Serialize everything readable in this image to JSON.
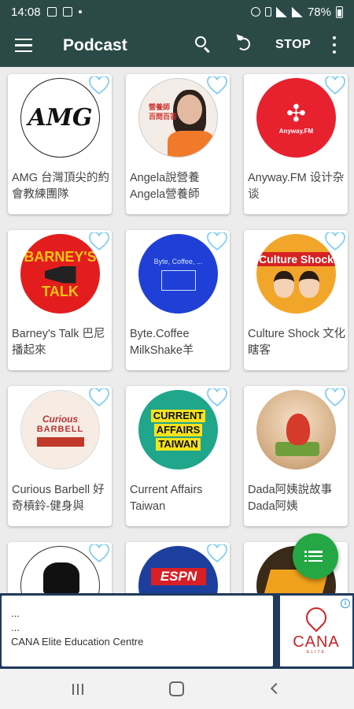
{
  "status": {
    "time": "14:08",
    "battery": "78%"
  },
  "app_bar": {
    "title": "Podcast",
    "stop_label": "STOP"
  },
  "podcasts": [
    {
      "title": "AMG 台灣頂尖的約會教練團隊",
      "cover_text": "AMG"
    },
    {
      "title": "Angela說營養Angela營養師",
      "cover_text": "營養師\n百問百答"
    },
    {
      "title": "Anyway.FM 设计杂谈",
      "cover_text": "Anyway.FM"
    },
    {
      "title": "Barney's Talk 巴尼播起來",
      "cover_text": "BARNEY'S TALK"
    },
    {
      "title": "Byte.Coffee MilkShake羊",
      "cover_text": "Byte, Coffee, ..."
    },
    {
      "title": "Culture Shock 文化瞎客",
      "cover_text": "Culture Shock"
    },
    {
      "title": "Curious Barbell 好奇槓鈴-健身與",
      "cover_text": "CURIOUS BARBELL"
    },
    {
      "title": "Current Affairs Taiwan",
      "cover_text": "CURRENT AFFAIRS TAIWAN"
    },
    {
      "title": "Dada阿姨說故事 Dada阿姨",
      "cover_text": ""
    },
    {
      "title": "",
      "cover_text": ""
    },
    {
      "title": "",
      "cover_text": "ESPN"
    },
    {
      "title": "",
      "cover_text": ""
    }
  ],
  "cover_labels": {
    "amg": "AMG",
    "angela_line1": "營養師",
    "angela_line2": "百問百答",
    "anyway_logo": "✣",
    "anyway_name": "Anyway.FM",
    "barney_1": "BARNEY'S",
    "barney_2": "TALK",
    "byte_text": "Byte, Coffee, ...",
    "culture_text": "Culture Shock",
    "curious_1": "Curious",
    "curious_2": "BARBELL",
    "current_1": "CURRENT",
    "current_2": "AFFAIRS",
    "current_3": "TAIWAN",
    "espn": "ESPN"
  },
  "ad": {
    "line1": "...",
    "line2": "...",
    "advertiser": "CANA Elite Education Centre",
    "brand": "CANA",
    "brand_sub": "ELITE"
  },
  "colors": {
    "app_bar": "#2b4a47",
    "heart_outline": "#80ccf2",
    "fab": "#24a744"
  }
}
